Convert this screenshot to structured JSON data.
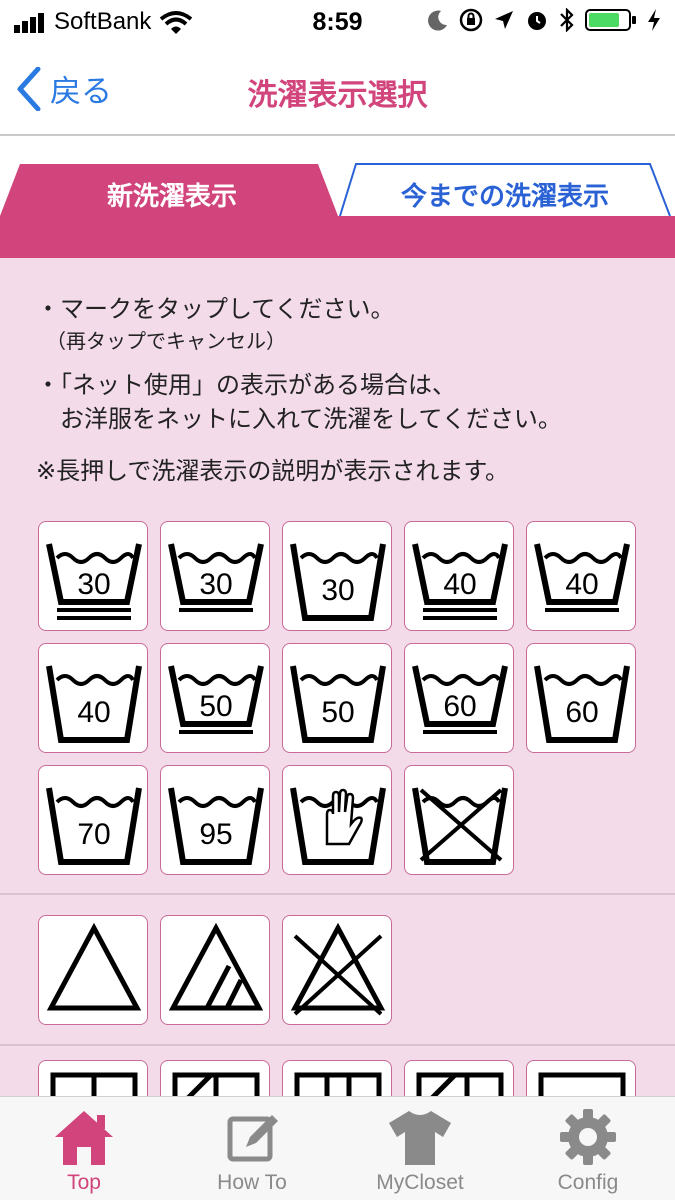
{
  "status_bar": {
    "carrier": "SoftBank",
    "time": "8:59"
  },
  "nav": {
    "back_label": "戻る",
    "title": "洗濯表示選択"
  },
  "tabs": [
    {
      "label": "新洗濯表示",
      "active": true
    },
    {
      "label": "今までの洗濯表示",
      "active": false
    }
  ],
  "instructions": {
    "line1": "・マークをタップしてください。",
    "line1_sub": "（再タップでキャンセル）",
    "line2": "・「ネット使用」の表示がある場合は、",
    "line2_cont": "　お洋服をネットに入れて洗濯をしてください。",
    "note": "※長押しで洗濯表示の説明が表示されます。"
  },
  "wash_symbols": [
    {
      "icon": "wash-tub-icon",
      "temp": "30",
      "bars": 2
    },
    {
      "icon": "wash-tub-icon",
      "temp": "30",
      "bars": 1
    },
    {
      "icon": "wash-tub-icon",
      "temp": "30",
      "bars": 0
    },
    {
      "icon": "wash-tub-icon",
      "temp": "40",
      "bars": 2
    },
    {
      "icon": "wash-tub-icon",
      "temp": "40",
      "bars": 1
    },
    {
      "icon": "wash-tub-icon",
      "temp": "40",
      "bars": 0
    },
    {
      "icon": "wash-tub-icon",
      "temp": "50",
      "bars": 1
    },
    {
      "icon": "wash-tub-icon",
      "temp": "50",
      "bars": 0
    },
    {
      "icon": "wash-tub-icon",
      "temp": "60",
      "bars": 1
    },
    {
      "icon": "wash-tub-icon",
      "temp": "60",
      "bars": 0
    },
    {
      "icon": "wash-tub-icon",
      "temp": "70",
      "bars": 0
    },
    {
      "icon": "wash-tub-icon",
      "temp": "95",
      "bars": 0
    },
    {
      "icon": "hand-wash-icon",
      "temp": "",
      "bars": 0
    },
    {
      "icon": "do-not-wash-icon",
      "temp": "",
      "bars": 0
    }
  ],
  "bleach_symbols": [
    {
      "icon": "bleach-allowed-icon"
    },
    {
      "icon": "oxygen-bleach-only-icon"
    },
    {
      "icon": "do-not-bleach-icon"
    }
  ],
  "drying_symbols": [
    {
      "icon": "line-dry-icon"
    },
    {
      "icon": "line-dry-shade-icon"
    },
    {
      "icon": "drip-dry-icon"
    },
    {
      "icon": "drip-dry-shade-icon"
    },
    {
      "icon": "flat-dry-icon"
    }
  ],
  "tab_bar": [
    {
      "label": "Top",
      "icon": "home-icon",
      "active": true
    },
    {
      "label": "How To",
      "icon": "edit-icon",
      "active": false
    },
    {
      "label": "MyCloset",
      "icon": "tshirt-icon",
      "active": false
    },
    {
      "label": "Config",
      "icon": "gear-icon",
      "active": false
    }
  ],
  "colors": {
    "accent": "#d1447c",
    "background": "#f3dbea",
    "link": "#2a7ae2",
    "inactive": "#8a8a8a"
  }
}
